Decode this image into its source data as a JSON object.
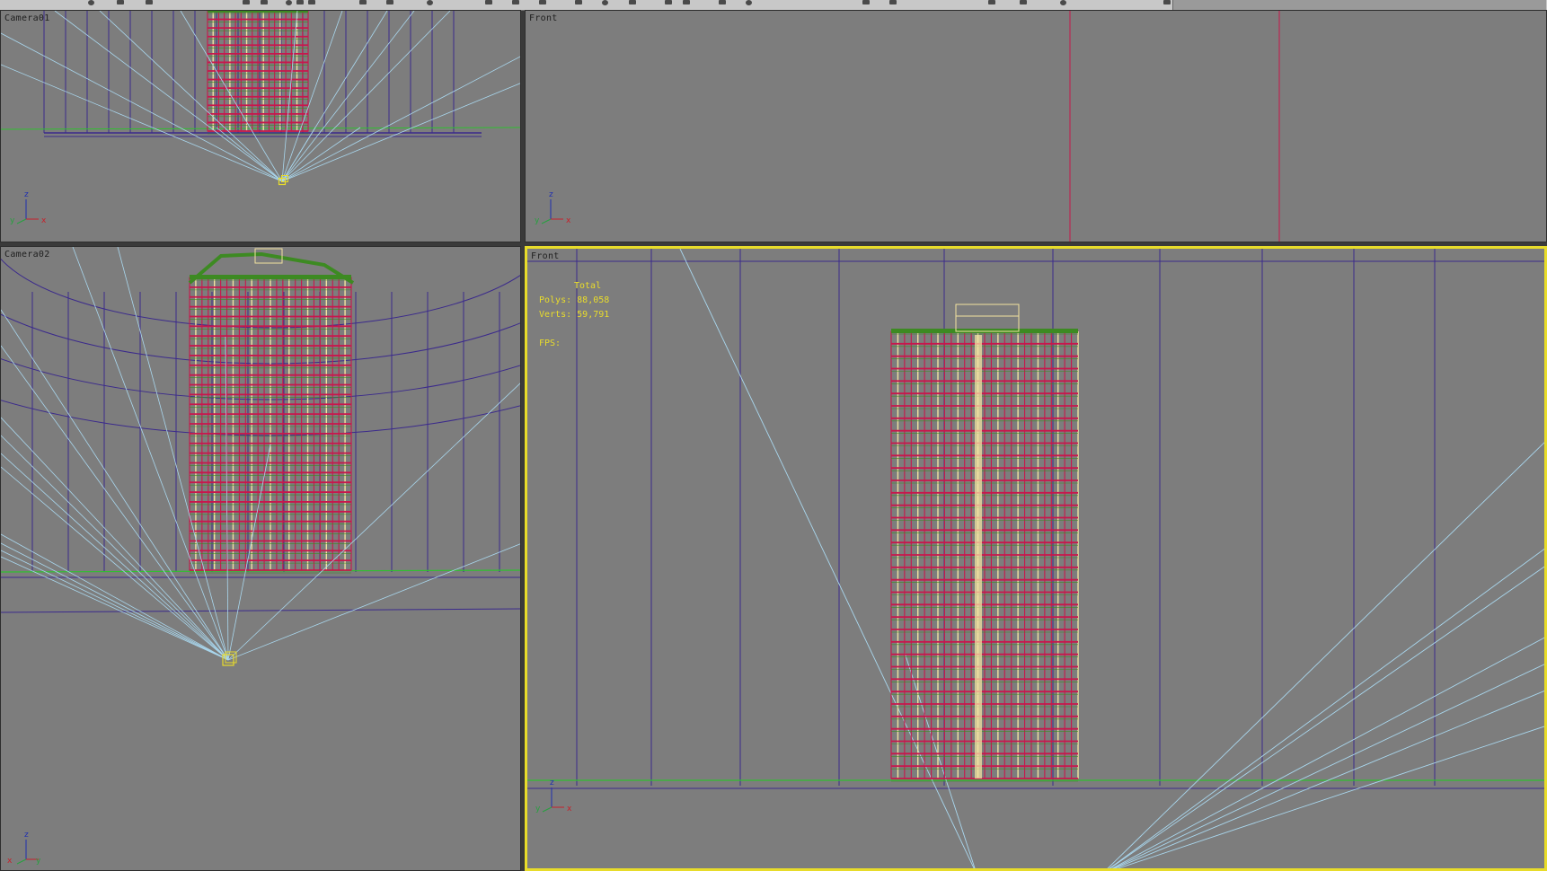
{
  "app": {
    "accent_active_border": "#e8dc2a",
    "viewport_bg": "#7d7d7d"
  },
  "toolbar": {
    "icons": [
      "toolbar-icon"
    ]
  },
  "viewports": {
    "top_left": {
      "label": "Camera01"
    },
    "top_right": {
      "label": "Front"
    },
    "bottom_left": {
      "label": "Camera02"
    },
    "bottom_right": {
      "label": "Front",
      "active": true,
      "stats": {
        "total_label": "Total",
        "polys_label": "Polys:",
        "polys_value": "88,058",
        "verts_label": "Verts:",
        "verts_value": "59,791",
        "fps_label": "FPS:"
      }
    }
  },
  "axes": {
    "x": "x",
    "y": "y",
    "z": "z",
    "colors": {
      "x": "#c8202a",
      "y": "#28a040",
      "z": "#2030b0"
    }
  },
  "scene_colors": {
    "grid": "#3b2a8c",
    "camera_lines": "#a9d7ee",
    "ground": "#30c030",
    "building_frame": "#c8174c",
    "building_light": "#f2e2a0",
    "roof": "#3d8a22",
    "camera": "#e8dc2a"
  }
}
